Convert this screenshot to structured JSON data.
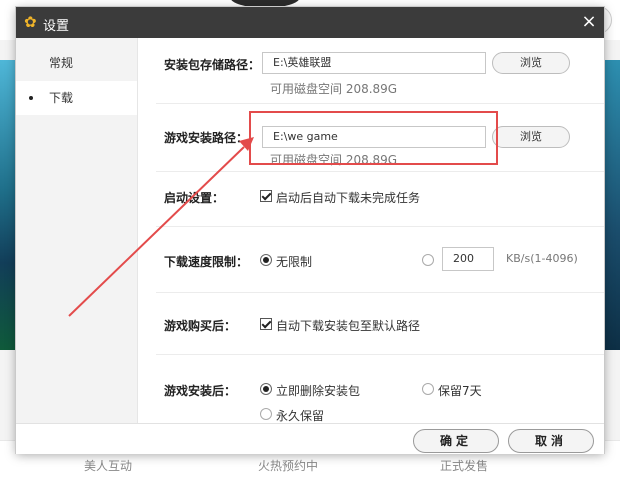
{
  "background": {
    "footer_items": [
      "美人互动",
      "火热预约中",
      "正式发售"
    ]
  },
  "dialog": {
    "title": "设置",
    "close_glyph": "×",
    "title_icon": "gear-icon"
  },
  "sidebar": {
    "items": [
      {
        "label": "常规",
        "active": false
      },
      {
        "label": "下载",
        "active": true
      }
    ]
  },
  "settings": {
    "install_package_path": {
      "label": "安装包存储路径：",
      "value": "E:\\英雄联盟",
      "free_space": "可用磁盘空间 208.89G",
      "browse_label": "浏览"
    },
    "game_install_path": {
      "label": "游戏安装路径：",
      "value": "E:\\we game",
      "free_space": "可用磁盘空间 208.89G",
      "browse_label": "浏览"
    },
    "startup": {
      "label": "启动设置：",
      "option": "启动后自动下载未完成任务",
      "checked": true
    },
    "speed_limit": {
      "label": "下载速度限制：",
      "unlimited_label": "无限制",
      "unlimited_selected": true,
      "limit_value": "200",
      "unit": "KB/s(1-4096)"
    },
    "after_purchase": {
      "label": "游戏购买后：",
      "option": "自动下载安装包至默认路径",
      "checked": true
    },
    "after_install": {
      "label": "游戏安装后：",
      "options": [
        {
          "label": "立即删除安装包",
          "selected": true
        },
        {
          "label": "保留7天",
          "selected": false
        },
        {
          "label": "永久保留",
          "selected": false
        }
      ]
    }
  },
  "footer": {
    "confirm_label": "确定",
    "cancel_label": "取消"
  },
  "colors": {
    "annotation_red": "#e34b4b",
    "titlebar": "#3b3b3b"
  }
}
